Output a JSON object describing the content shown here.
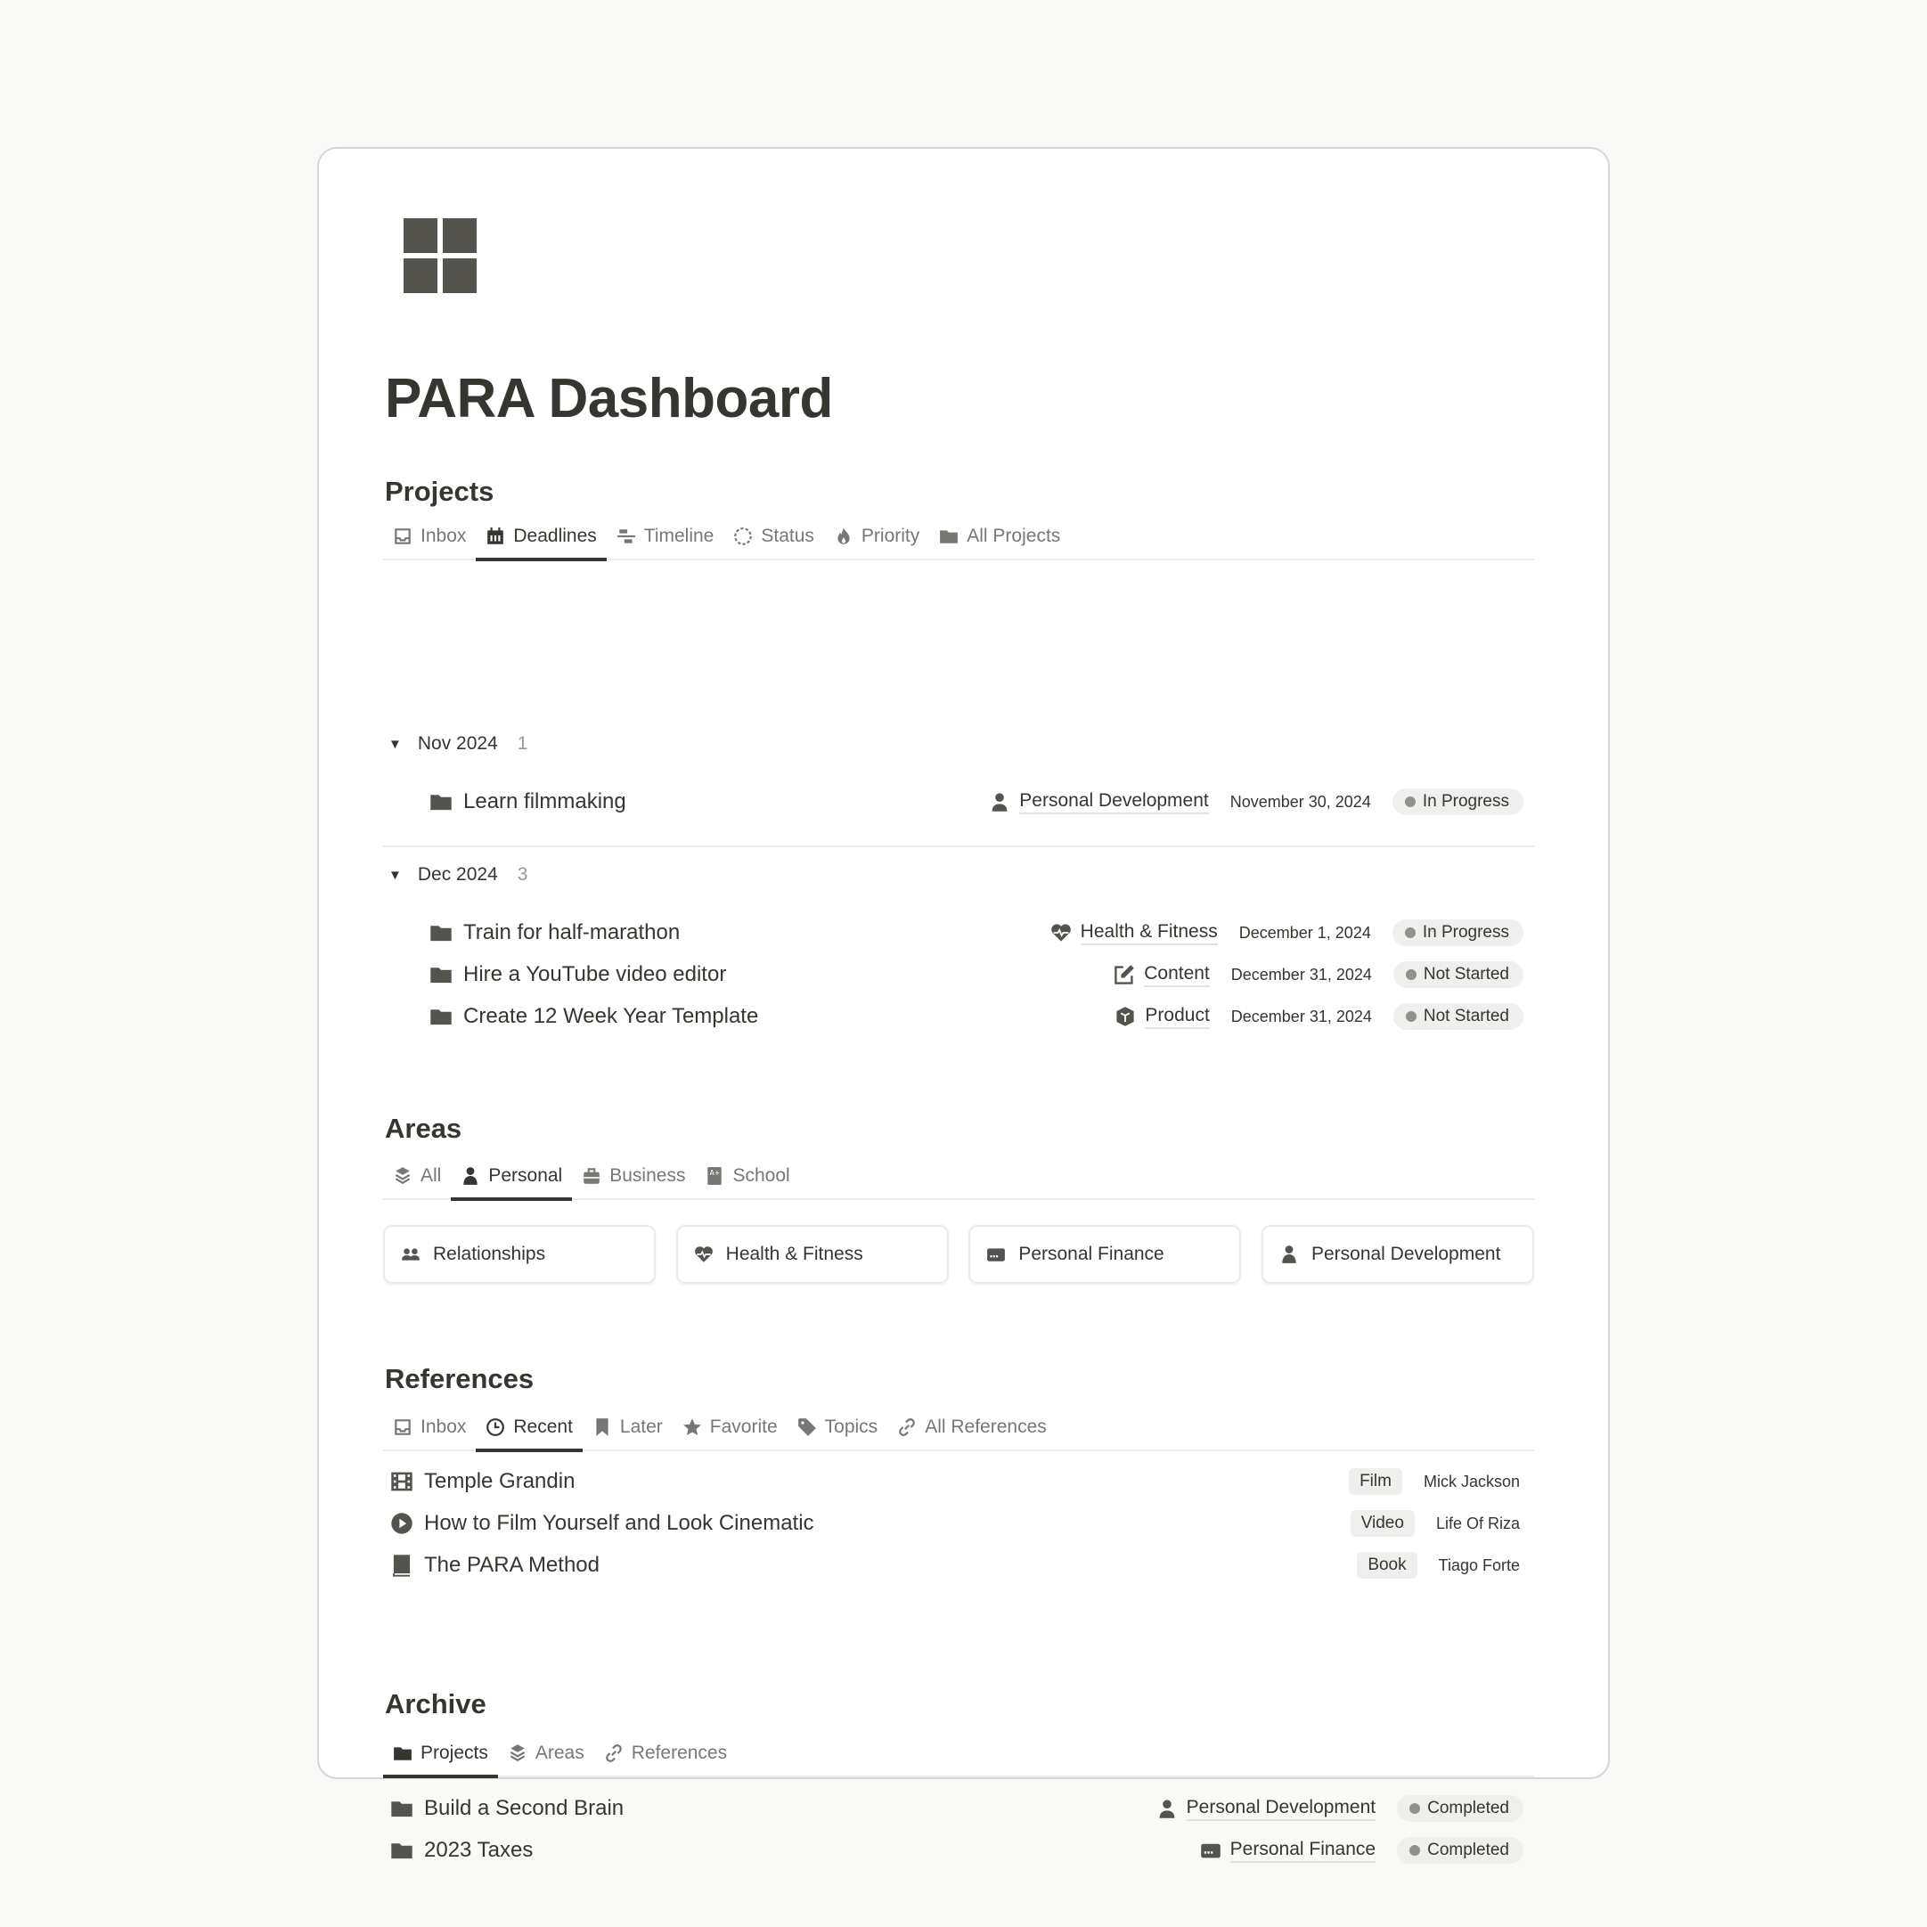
{
  "page": {
    "title": "PARA Dashboard",
    "icon": "grid-icon"
  },
  "projects": {
    "heading": "Projects",
    "tabs": [
      {
        "label": "Inbox",
        "icon": "inbox-icon",
        "active": false
      },
      {
        "label": "Deadlines",
        "icon": "calendar-icon",
        "active": true
      },
      {
        "label": "Timeline",
        "icon": "timeline-icon",
        "active": false
      },
      {
        "label": "Status",
        "icon": "status-circle-icon",
        "active": false
      },
      {
        "label": "Priority",
        "icon": "flame-icon",
        "active": false
      },
      {
        "label": "All Projects",
        "icon": "folder-icon",
        "active": false
      }
    ],
    "groups": [
      {
        "label": "Nov 2024",
        "count": "1",
        "items": [
          {
            "name": "Learn filmmaking",
            "area": "Personal Development",
            "area_icon": "person-icon",
            "date": "November 30, 2024",
            "status": "In Progress"
          }
        ]
      },
      {
        "label": "Dec 2024",
        "count": "3",
        "items": [
          {
            "name": "Train for half-marathon",
            "area": "Health & Fitness",
            "area_icon": "heart-pulse-icon",
            "date": "December 1, 2024",
            "status": "In Progress"
          },
          {
            "name": "Hire a YouTube video editor",
            "area": "Content",
            "area_icon": "edit-icon",
            "date": "December 31, 2024",
            "status": "Not Started"
          },
          {
            "name": "Create 12 Week Year Template",
            "area": "Product",
            "area_icon": "box-icon",
            "date": "December 31, 2024",
            "status": "Not Started"
          }
        ]
      }
    ]
  },
  "areas": {
    "heading": "Areas",
    "tabs": [
      {
        "label": "All",
        "icon": "layers-icon",
        "active": false
      },
      {
        "label": "Personal",
        "icon": "person-icon",
        "active": true
      },
      {
        "label": "Business",
        "icon": "briefcase-icon",
        "active": false
      },
      {
        "label": "School",
        "icon": "grade-book-icon",
        "active": false
      }
    ],
    "cards": [
      {
        "label": "Relationships",
        "icon": "people-icon"
      },
      {
        "label": "Health & Fitness",
        "icon": "heart-pulse-icon"
      },
      {
        "label": "Personal Finance",
        "icon": "wallet-card-icon"
      },
      {
        "label": "Personal Development",
        "icon": "person-icon"
      }
    ]
  },
  "references": {
    "heading": "References",
    "tabs": [
      {
        "label": "Inbox",
        "icon": "inbox-icon",
        "active": false
      },
      {
        "label": "Recent",
        "icon": "clock-icon",
        "active": true
      },
      {
        "label": "Later",
        "icon": "bookmark-icon",
        "active": false
      },
      {
        "label": "Favorite",
        "icon": "star-icon",
        "active": false
      },
      {
        "label": "Topics",
        "icon": "tag-icon",
        "active": false
      },
      {
        "label": "All References",
        "icon": "link-icon",
        "active": false
      }
    ],
    "items": [
      {
        "name": "Temple Grandin",
        "icon": "film-icon",
        "type": "Film",
        "author": "Mick Jackson"
      },
      {
        "name": "How to Film Yourself and Look Cinematic",
        "icon": "play-circle-icon",
        "type": "Video",
        "author": "Life Of Riza"
      },
      {
        "name": "The PARA Method",
        "icon": "book-icon",
        "type": "Book",
        "author": "Tiago Forte"
      }
    ]
  },
  "archive": {
    "heading": "Archive",
    "tabs": [
      {
        "label": "Projects",
        "icon": "folder-icon",
        "active": true
      },
      {
        "label": "Areas",
        "icon": "layers-icon",
        "active": false
      },
      {
        "label": "References",
        "icon": "link-icon",
        "active": false
      }
    ],
    "items": [
      {
        "name": "Build a Second Brain",
        "area": "Personal Development",
        "area_icon": "person-icon",
        "status": "Completed"
      },
      {
        "name": "2023 Taxes",
        "area": "Personal Finance",
        "area_icon": "wallet-card-icon",
        "status": "Completed"
      }
    ]
  },
  "colors": {
    "text": "#37352f",
    "muted": "#787774",
    "icon": "#55534e",
    "pill_bg": "#efefed",
    "status_dot": "#91918e"
  }
}
